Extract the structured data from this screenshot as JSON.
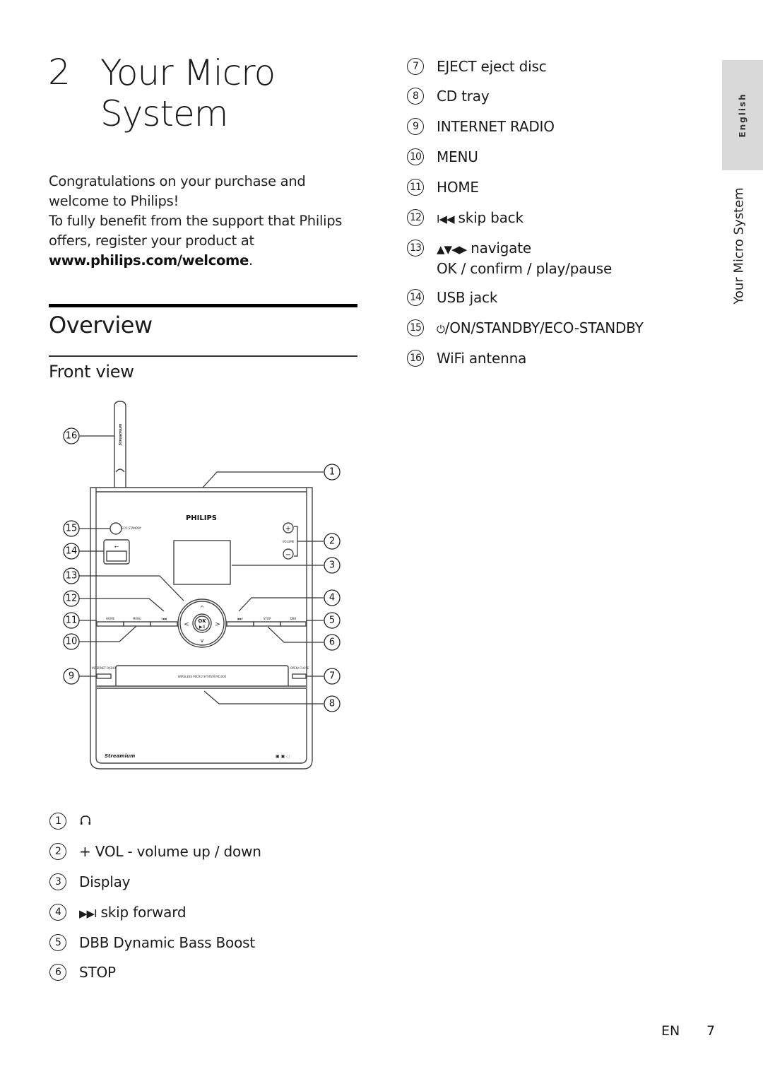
{
  "chapter": {
    "number": "2",
    "title": "Your Micro System"
  },
  "intro": {
    "line1": "Congratulations on your purchase and welcome to Philips!",
    "line2_prefix": "To fully benefit from the support that Philips offers, register your product at ",
    "url": "www.philips.com/welcome",
    "line2_suffix": "."
  },
  "sections": {
    "overview": "Overview",
    "front_view": "Front view"
  },
  "legend_left": [
    {
      "num": "1",
      "icon": "headphones-icon",
      "text": ""
    },
    {
      "num": "2",
      "text": "+ VOL - volume up / down"
    },
    {
      "num": "3",
      "text": "Display"
    },
    {
      "num": "4",
      "glyph": "▶▶I",
      "text": "skip forward"
    },
    {
      "num": "5",
      "text": "DBB Dynamic Bass Boost"
    },
    {
      "num": "6",
      "text": "STOP"
    }
  ],
  "legend_right": [
    {
      "num": "7",
      "text": "EJECT eject disc"
    },
    {
      "num": "8",
      "text": "CD tray"
    },
    {
      "num": "9",
      "text": "INTERNET RADIO"
    },
    {
      "num": "10",
      "text": "MENU"
    },
    {
      "num": "11",
      "text": "HOME"
    },
    {
      "num": "12",
      "glyph": "I◀◀",
      "text": "skip back"
    },
    {
      "num": "13",
      "glyph": "▲▼◀▶",
      "text": "navigate",
      "text2": "OK /  confirm / play/pause"
    },
    {
      "num": "14",
      "text": "USB jack"
    },
    {
      "num": "15",
      "glyph": "⏻",
      "text": "/ON/STANDBY/ECO-STANDBY"
    },
    {
      "num": "16",
      "text": "WiFi antenna"
    }
  ],
  "diagram": {
    "brand": "PHILIPS",
    "model": "WIRELESS MICRO SYSTEM MCi300",
    "antenna_label": "Streamium",
    "bottom_logo": "Streamium",
    "volume_label": "VOLUME",
    "eco_label": "ECO STANDBY",
    "ok_label": "OK",
    "buttons": [
      "HOME",
      "MENU",
      "I◀◀",
      "▶▶I",
      "STOP",
      "DBB"
    ],
    "internet_radio_label": "INTERNET RADIO",
    "open_close_label": "OPEN/ CLOSE",
    "callouts": [
      "1",
      "2",
      "3",
      "4",
      "5",
      "6",
      "7",
      "8",
      "9",
      "10",
      "11",
      "12",
      "13",
      "14",
      "15",
      "16"
    ]
  },
  "sidebar": {
    "language": "English",
    "section_title": "Your Micro System"
  },
  "footer": {
    "lang": "EN",
    "page": "7"
  }
}
